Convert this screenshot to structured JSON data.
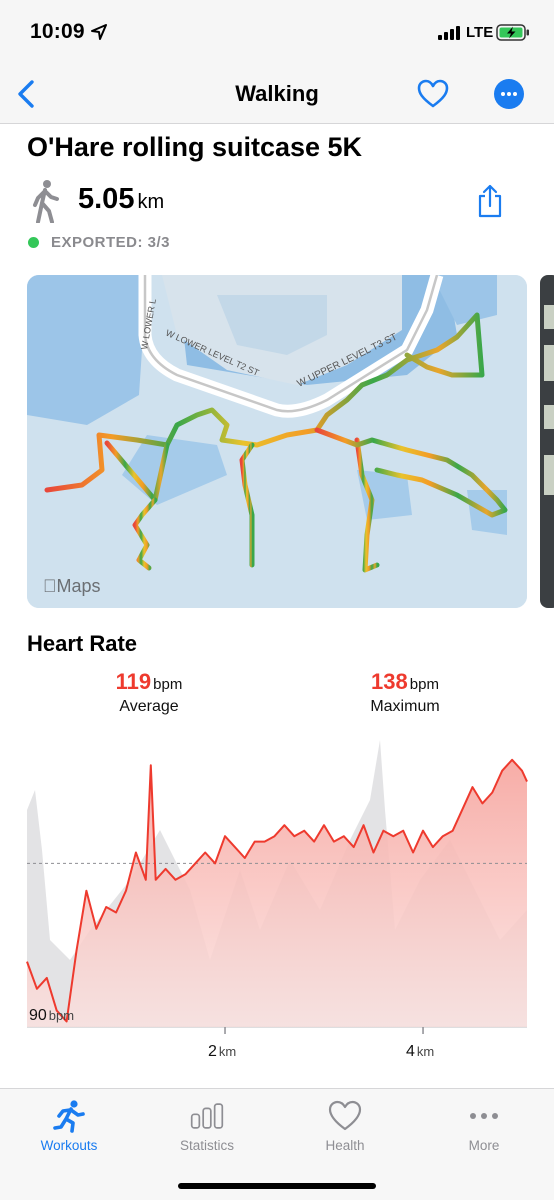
{
  "status_bar": {
    "time": "10:09",
    "network": "LTE"
  },
  "nav": {
    "title": "Walking"
  },
  "workout": {
    "title": "O'Hare rolling suitcase 5K",
    "distance_value": "5.05",
    "distance_unit": "km",
    "export_status": "EXPORTED: 3/3"
  },
  "map": {
    "attribution": "Maps",
    "street_labels": [
      "W LOWER LEVEL T2 ST",
      "W UPPER LEVEL T3 ST",
      "W LOWER L"
    ]
  },
  "heart_rate": {
    "title": "Heart Rate",
    "average_value": "119",
    "average_unit": "bpm",
    "average_label": "Average",
    "maximum_value": "138",
    "maximum_unit": "bpm",
    "maximum_label": "Maximum"
  },
  "chart_data": {
    "type": "line",
    "y_tick": {
      "value": "90",
      "unit": "bpm"
    },
    "x_ticks": [
      {
        "value": "2",
        "unit": "km"
      },
      {
        "value": "4",
        "unit": "km"
      }
    ],
    "xlim": [
      0,
      5.05
    ],
    "ylim": [
      89,
      142
    ],
    "average_line": 119,
    "line_color": "#ee3a2e",
    "series": [
      {
        "x": [
          0,
          0.1,
          0.2,
          0.3,
          0.4,
          0.5,
          0.6,
          0.7,
          0.8,
          0.9,
          1.0,
          1.1,
          1.2,
          1.25,
          1.3,
          1.4,
          1.5,
          1.6,
          1.7,
          1.8,
          1.9,
          2.0,
          2.1,
          2.2,
          2.3,
          2.4,
          2.5,
          2.6,
          2.7,
          2.8,
          2.9,
          3.0,
          3.1,
          3.2,
          3.3,
          3.4,
          3.5,
          3.6,
          3.7,
          3.8,
          3.9,
          4.0,
          4.1,
          4.2,
          4.3,
          4.4,
          4.5,
          4.6,
          4.7,
          4.8,
          4.9,
          5.0,
          5.05
        ],
        "y": [
          101,
          96,
          98,
          92,
          90,
          103,
          114,
          107,
          111,
          110,
          114,
          121,
          116,
          137,
          116,
          118,
          116,
          117,
          119,
          121,
          119,
          124,
          122,
          120,
          123,
          123,
          124,
          126,
          124,
          125,
          123,
          126,
          123,
          124,
          122,
          126,
          121,
          125,
          124,
          125,
          121,
          125,
          122,
          124,
          125,
          129,
          133,
          130,
          132,
          136,
          138,
          136,
          134
        ]
      }
    ]
  },
  "tab_bar": {
    "items": [
      {
        "label": "Workouts",
        "icon": "figure-run-icon",
        "active": true
      },
      {
        "label": "Statistics",
        "icon": "bar-chart-icon",
        "active": false
      },
      {
        "label": "Health",
        "icon": "heart-icon",
        "active": false
      },
      {
        "label": "More",
        "icon": "ellipsis-icon",
        "active": false
      }
    ]
  }
}
